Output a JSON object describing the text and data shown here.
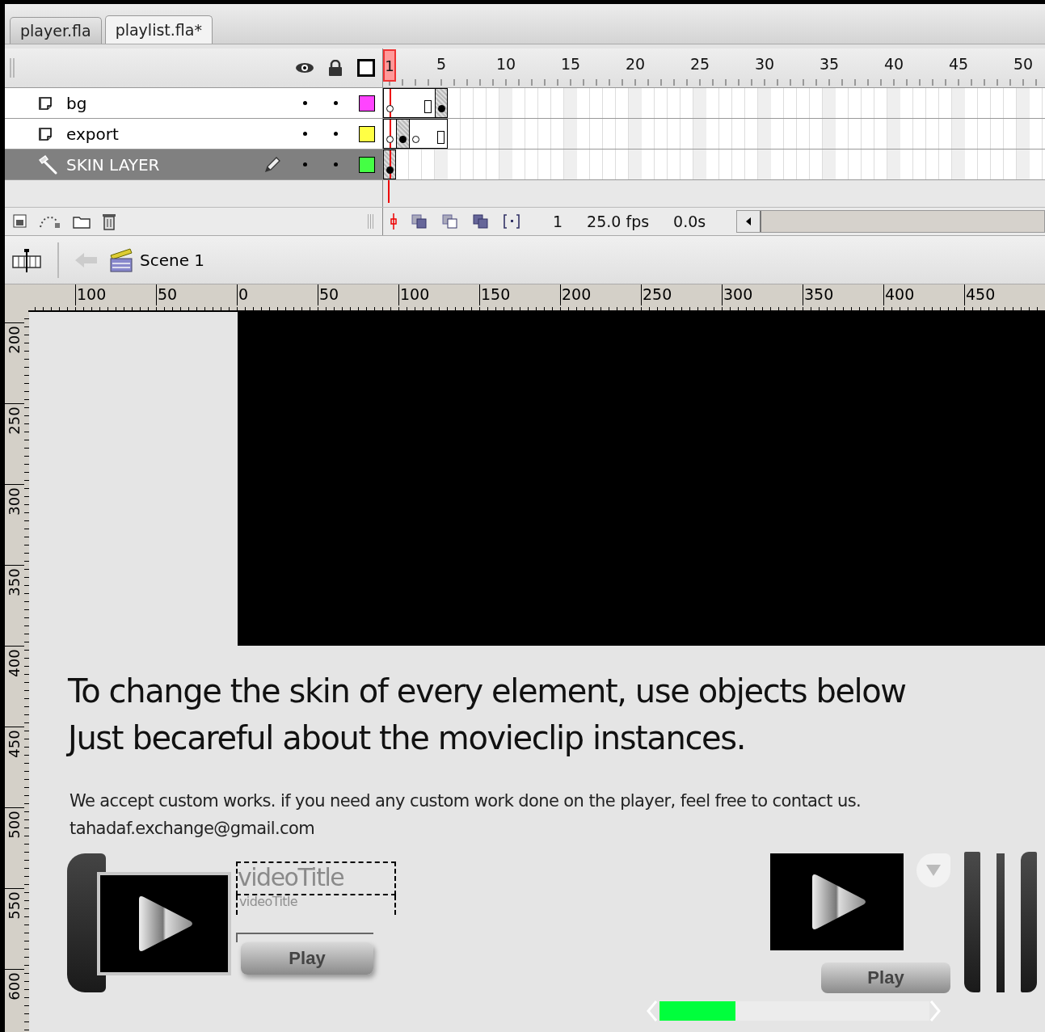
{
  "tabs": [
    {
      "label": "player.fla",
      "selected": false
    },
    {
      "label": "playlist.fla*",
      "selected": true
    }
  ],
  "timeline": {
    "frame_numbers": [
      {
        "label": "1",
        "selected": true
      },
      {
        "label": "5",
        "selected": false
      },
      {
        "label": "10",
        "selected": false
      },
      {
        "label": "15",
        "selected": false
      },
      {
        "label": "20",
        "selected": false
      },
      {
        "label": "25",
        "selected": false
      },
      {
        "label": "30",
        "selected": false
      },
      {
        "label": "35",
        "selected": false
      },
      {
        "label": "40",
        "selected": false
      },
      {
        "label": "45",
        "selected": false
      },
      {
        "label": "50",
        "selected": false
      }
    ],
    "layers": [
      {
        "name": "bg",
        "kind": "normal",
        "selected": false,
        "color": "#ff44ff",
        "frames": [
          {
            "kind": "blank-key"
          },
          {
            "kind": "span"
          },
          {
            "kind": "span"
          },
          {
            "kind": "end"
          },
          {
            "kind": "key"
          }
        ]
      },
      {
        "name": "export",
        "kind": "normal",
        "selected": false,
        "color": "#ffff44",
        "frames": [
          {
            "kind": "blank-key"
          },
          {
            "kind": "key"
          },
          {
            "kind": "blank-key"
          },
          {
            "kind": "span"
          },
          {
            "kind": "end"
          }
        ]
      },
      {
        "name": "SKIN LAYER",
        "kind": "guide",
        "selected": true,
        "color": "#44ff44",
        "frames": [
          {
            "kind": "key"
          }
        ]
      }
    ],
    "status": {
      "current_frame": "1",
      "frame_rate": "25.0 fps",
      "elapsed": "0.0s"
    }
  },
  "edit_bar": {
    "scene": "Scene 1"
  },
  "stage": {
    "h_ruler": [
      "100",
      "50",
      "0",
      "50",
      "100",
      "150",
      "200",
      "250",
      "300",
      "350",
      "400",
      "450"
    ],
    "v_ruler": [
      "200",
      "250",
      "300",
      "350",
      "400",
      "450",
      "500",
      "550",
      "600"
    ],
    "heading": [
      "To change the skin of every element, use objects below",
      "Just becareful about the movieclip instances."
    ],
    "note": "We accept custom works. if you need any custom work done on the player, feel free to contact us.",
    "email": "tahadaf.exchange@gmail.com",
    "playlist_item": {
      "title": "videoTitle",
      "subtitle": "videoTitle",
      "button": "Play"
    },
    "player": {
      "button": "Play",
      "scroll": {
        "level": 0.28
      }
    }
  }
}
